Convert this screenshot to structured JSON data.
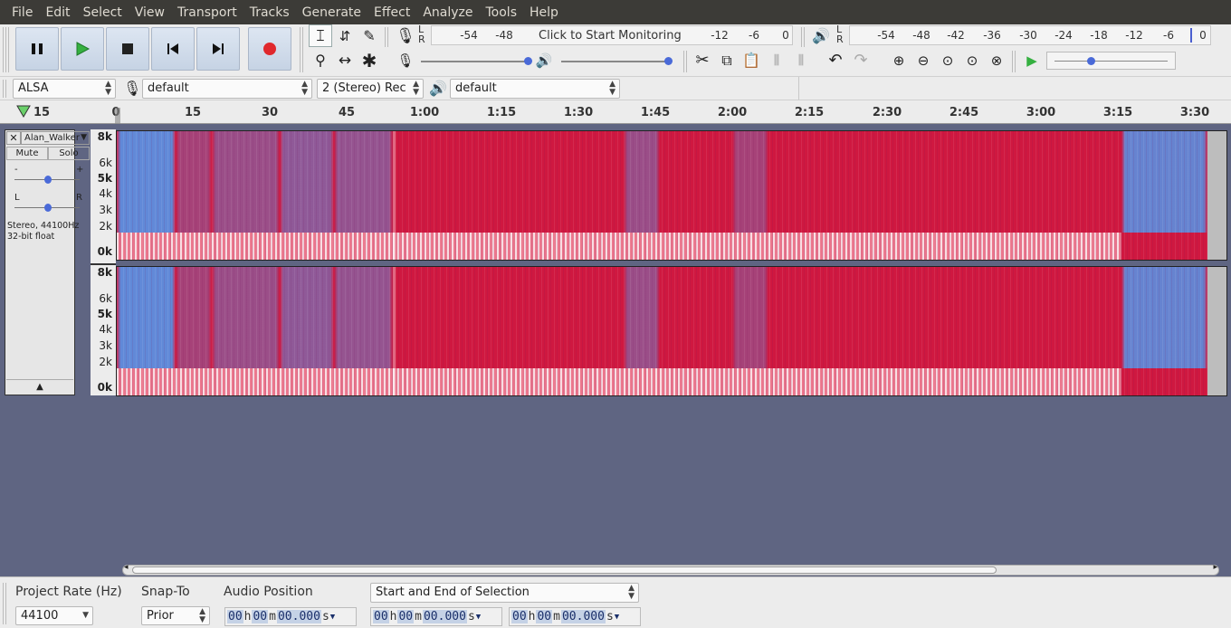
{
  "menu": [
    "File",
    "Edit",
    "Select",
    "View",
    "Transport",
    "Tracks",
    "Generate",
    "Effect",
    "Analyze",
    "Tools",
    "Help"
  ],
  "record_meter": {
    "lr": "L\nR",
    "ticks": [
      "-54",
      "-48",
      "-12",
      "-6",
      "0"
    ],
    "prompt": "Click to Start Monitoring"
  },
  "play_meter": {
    "lr": "L\nR",
    "ticks": [
      "-54",
      "-48",
      "-42",
      "-36",
      "-30",
      "-24",
      "-18",
      "-12",
      "-6",
      "0"
    ]
  },
  "devices": {
    "host": "ALSA",
    "rec_device": "default",
    "channels": "2 (Stereo) Rec",
    "play_device": "default"
  },
  "ruler_labels": [
    "15",
    "0",
    "15",
    "30",
    "45",
    "1:00",
    "1:15",
    "1:30",
    "1:45",
    "2:00",
    "2:15",
    "2:30",
    "2:45",
    "3:00",
    "3:15",
    "3:30"
  ],
  "track": {
    "name": "Alan_Walker",
    "mute": "Mute",
    "solo": "Solo",
    "gain_minus": "-",
    "gain_plus": "+",
    "pan_l": "L",
    "pan_r": "R",
    "info1": "Stereo, 44100Hz",
    "info2": "32-bit float"
  },
  "freq_labels": [
    "8k",
    "6k",
    "5k",
    "4k",
    "3k",
    "2k",
    "0k"
  ],
  "selection": {
    "project_rate_label": "Project Rate (Hz)",
    "project_rate": "44100",
    "snap_label": "Snap-To",
    "snap": "Prior",
    "audio_pos_label": "Audio Position",
    "sel_mode": "Start and End of Selection",
    "time": {
      "hh": "00",
      "h": "h",
      "mm": "00",
      "m": "m",
      "ss": "00.000",
      "s": "s"
    }
  },
  "colors": {
    "menubar": "#3c3b37",
    "spectro_red": "#d8173c",
    "spectro_blue": "#5b8fe0",
    "background": "#5f6582",
    "record": "#e0282d",
    "play": "#35b040"
  }
}
